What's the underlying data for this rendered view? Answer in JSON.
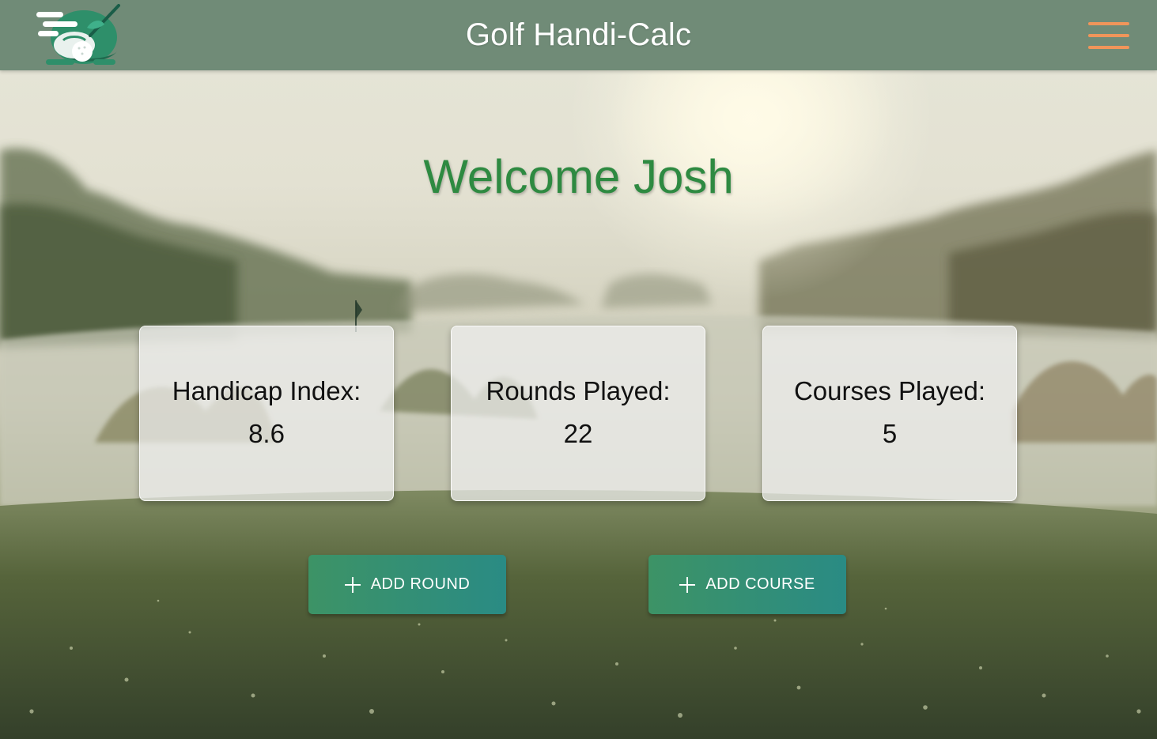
{
  "header": {
    "title": "Golf Handi-Calc",
    "logo_icon": "golf-ball-club-icon",
    "menu_icon": "hamburger-menu-icon",
    "menu_color": "#f0955a",
    "background_color": "#708b77"
  },
  "main": {
    "welcome": "Welcome Josh",
    "welcome_color": "#2e8a41",
    "stats": [
      {
        "label": "Handicap Index:",
        "value": "8.6"
      },
      {
        "label": "Rounds Played:",
        "value": "22"
      },
      {
        "label": "Courses Played:",
        "value": "5"
      }
    ],
    "actions": {
      "add_round": "ADD ROUND",
      "add_course": "ADD COURSE",
      "icon": "plus-icon"
    },
    "background_image": "misty-golf-course-photo"
  }
}
